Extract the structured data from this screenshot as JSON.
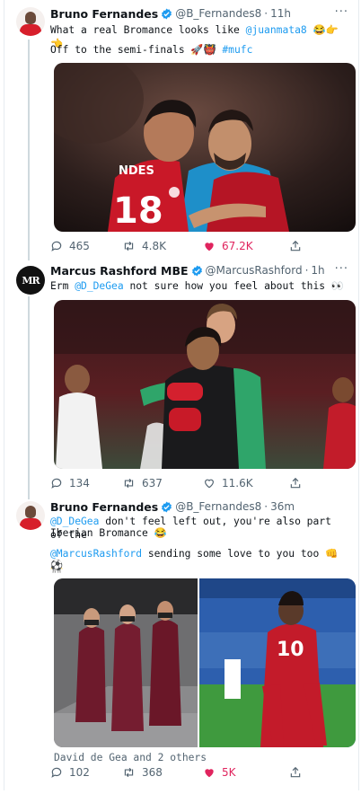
{
  "tweets": [
    {
      "name": "Bruno Fernandes",
      "handle": "@B_Fernandes8",
      "sep": "·",
      "time": "11h",
      "line1_pre": "What a real Bromance looks like ",
      "line1_mention": "@juanmata8",
      "line1_emoji": " 😂👉👈",
      "line2_pre": "Off to the semi-finals 🚀👹 ",
      "line2_tag": "#mufc",
      "replies": "465",
      "retweets": "4.8K",
      "likes": "67.2K"
    },
    {
      "name": "Marcus Rashford MBE",
      "handle": "@MarcusRashford",
      "sep": "·",
      "time": "1h",
      "line1_pre": "Erm ",
      "line1_mention": "@D_DeGea",
      "line1_post": " not sure how you feel about this 👀",
      "replies": "134",
      "retweets": "637",
      "likes": "11.6K"
    },
    {
      "name": "Bruno Fernandes",
      "handle": "@B_Fernandes8",
      "sep": "·",
      "time": "36m",
      "line1_mention": "@D_DeGea",
      "line1_post": " don't feel left out, you're also part of the",
      "line2": "Iberian Bromance 😂",
      "line3_mention": "@MarcusRashford",
      "line3_post": " sending some love to you too 👊👬",
      "line4": "⚽",
      "tagged": "David de Gea and 2 others",
      "replies": "102",
      "retweets": "368",
      "likes": "5K"
    }
  ],
  "media": {
    "shirt_number_1": "18",
    "shirt_name_1": "NDES",
    "shirt_number_2": "10"
  },
  "colors": {
    "link": "#1d9bf0",
    "like": "#e0245e",
    "united_red": "#d71f2b",
    "keeper_green": "#2fa56a",
    "verified": "#1d9bf0"
  },
  "icons": [
    "reply-icon",
    "retweet-icon",
    "heart-icon",
    "share-icon",
    "more-icon",
    "verified-icon"
  ]
}
